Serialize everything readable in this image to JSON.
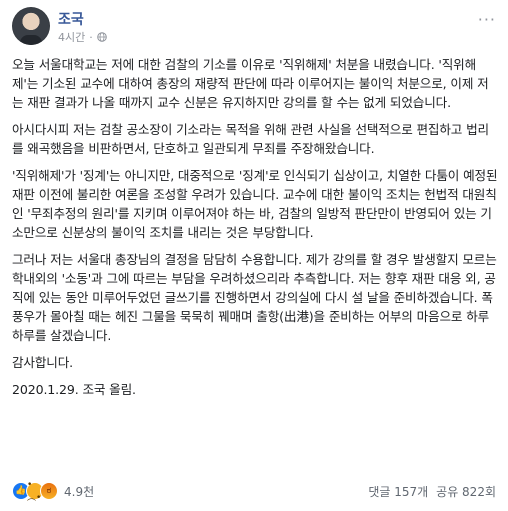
{
  "post": {
    "author": "조국",
    "time": "4시간",
    "privacy_icon": "globe-icon",
    "more_icon": "more-options-icon",
    "paragraphs": [
      "오늘 서울대학교는 저에 대한 검찰의 기소를 이유로 '직위해제' 처분을 내렸습니다. '직위해제'는 기소된 교수에 대하여 총장의 재량적 판단에 따라 이루어지는 불이익 처분으로, 이제 저는 재판 결과가 나올 때까지 교수 신분은 유지하지만 강의를 할 수는 없게 되었습니다.",
      "아시다시피 저는 검찰 공소장이 기소라는 목적을 위해 관련 사실을 선택적으로 편집하고 법리를 왜곡했음을 비판하면서, 단호하고 일관되게 무죄를 주장해왔습니다.",
      "'직위해제'가 '징계'는 아니지만, 대중적으로 '징계'로 인식되기 십상이고, 치열한 다툼이 예정된 재판 이전에 불리한 여론을 조성할 우려가 있습니다. 교수에 대한 불이익 조치는 헌법적 대원칙인 '무죄추정의 원리'를 지키며 이루어져야 하는 바, 검찰의 일방적 판단만이 반영되어 있는 기소만으로 신분상의 불이익 조치를 내리는 것은 부당합니다.",
      "그러나 저는 서울대 총장님의 결정을 담담히 수용합니다. 제가 강의를 할 경우 발생할지 모르는 학내외의 '소동'과 그에 따르는 부담을 우려하셨으리라 추측합니다. 저는 향후 재판 대응 외, 공직에 있는 동안 미루어두었던 글쓰기를 진행하면서 강의실에 다시 설 날을 준비하겠습니다. 폭풍우가 몰아칠 때는 헤진 그물을 묵묵히 꿰매며 출항(出港)을 준비하는 어부의 마음으로 하루하루를 살겠습니다.",
      "감사합니다.",
      "2020.1.29. 조국 올림."
    ]
  },
  "footer": {
    "reactions": [
      "like-icon",
      "sad-icon",
      "angry-icon"
    ],
    "reaction_count": "4.9천",
    "comments": "댓글 157개",
    "shares": "공유 822회"
  },
  "colors": {
    "author": "#385898",
    "meta": "#90949c",
    "like": "#1877f2"
  }
}
